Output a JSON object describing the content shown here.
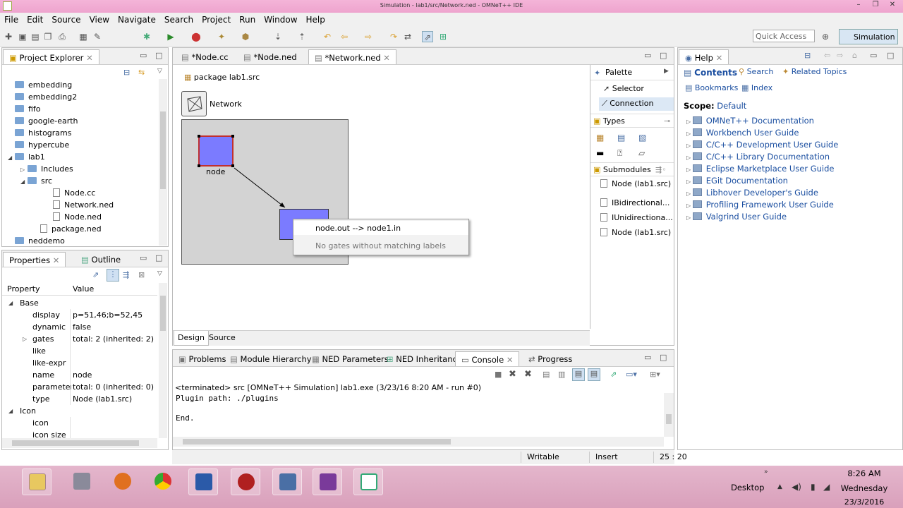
{
  "window": {
    "title": "Simulation - lab1/src/Network.ned - OMNeT++ IDE",
    "minimize": "–",
    "restore": "❐",
    "close": "✕"
  },
  "menu": [
    "File",
    "Edit",
    "Source",
    "View",
    "Navigate",
    "Search",
    "Project",
    "Run",
    "Window",
    "Help"
  ],
  "toolbar": {
    "quick_access": "Quick Access",
    "perspective": "Simulation"
  },
  "project_explorer": {
    "tab": "Project Explorer",
    "items": [
      {
        "label": "embedding",
        "type": "folder",
        "indent": 1
      },
      {
        "label": "embedding2",
        "type": "folder",
        "indent": 1
      },
      {
        "label": "fifo",
        "type": "folder",
        "indent": 1
      },
      {
        "label": "google-earth",
        "type": "folder",
        "indent": 1
      },
      {
        "label": "histograms",
        "type": "folder",
        "indent": 1
      },
      {
        "label": "hypercube",
        "type": "folder",
        "indent": 1
      },
      {
        "label": "lab1",
        "type": "folder-open",
        "indent": 1
      },
      {
        "label": "Includes",
        "type": "folder",
        "indent": 2
      },
      {
        "label": "src",
        "type": "folder-open",
        "indent": 2
      },
      {
        "label": "Node.cc",
        "type": "file",
        "indent": 3
      },
      {
        "label": "Network.ned",
        "type": "file",
        "indent": 3
      },
      {
        "label": "Node.ned",
        "type": "file",
        "indent": 3
      },
      {
        "label": "package.ned",
        "type": "file",
        "indent": 2
      },
      {
        "label": "neddemo",
        "type": "folder",
        "indent": 1
      }
    ]
  },
  "properties": {
    "tab": "Properties",
    "tab2": "Outline",
    "col_property": "Property",
    "col_value": "Value",
    "rows": [
      {
        "p": "Base",
        "v": "",
        "level": 0
      },
      {
        "p": "display",
        "v": "p=51,46;b=52,45",
        "level": 1
      },
      {
        "p": "dynamic",
        "v": "false",
        "level": 1
      },
      {
        "p": "gates",
        "v": "total: 2 (inherited: 2)",
        "level": 1
      },
      {
        "p": "like",
        "v": "",
        "level": 1
      },
      {
        "p": "like-expr",
        "v": "",
        "level": 1
      },
      {
        "p": "name",
        "v": "node",
        "level": 1
      },
      {
        "p": "parameter",
        "v": "total: 0 (inherited: 0)",
        "level": 1
      },
      {
        "p": "type",
        "v": "Node (lab1.src)",
        "level": 1
      },
      {
        "p": "Icon",
        "v": "",
        "level": 0
      },
      {
        "p": "icon",
        "v": "",
        "level": 1
      },
      {
        "p": "icon size",
        "v": "",
        "level": 1
      }
    ]
  },
  "editor": {
    "tabs": [
      "*Node.cc",
      "*Node.ned",
      "*Network.ned"
    ],
    "package": "package lab1.src",
    "network_label": "Network",
    "node_label": "node",
    "popup": {
      "item1": "node.out --> node1.in",
      "item2": "No gates without matching labels"
    },
    "bottom_tabs": [
      "Design",
      "Source"
    ]
  },
  "palette": {
    "title": "Palette",
    "selector": "Selector",
    "connection": "Connection",
    "types": "Types",
    "submodules": "Submodules",
    "sub_items": [
      "IBidirectional...",
      "IUnidirectiona...",
      "Node (lab1.src)"
    ],
    "first_sub": "Node (lab1.src)"
  },
  "console": {
    "tabs": [
      "Problems",
      "Module Hierarchy",
      "NED Parameters",
      "NED Inheritance",
      "Console",
      "Progress"
    ],
    "status": "<terminated> src [OMNeT++ Simulation] lab1.exe (3/23/16 8:20 AM - run #0)",
    "lines": [
      "Plugin path: ./plugins",
      "",
      "End."
    ]
  },
  "help": {
    "tab": "Help",
    "contents": "Contents",
    "search": "Search",
    "related": "Related Topics",
    "bookmarks": "Bookmarks",
    "index": "Index",
    "scope_label": "Scope:",
    "scope_value": "Default",
    "items": [
      "OMNeT++ Documentation",
      "Workbench User Guide",
      "C/C++ Development User Guide",
      "C/C++ Library Documentation",
      "Eclipse Marketplace User Guide",
      "EGit Documentation",
      "Libhover Developer's Guide",
      "Profiling Framework User Guide",
      "Valgrind User Guide"
    ]
  },
  "statusbar": {
    "writable": "Writable",
    "insert": "Insert",
    "position": "25 : 20"
  },
  "taskbar": {
    "desktop": "Desktop",
    "time": "8:26 AM",
    "day": "Wednesday",
    "date": "23/3/2016"
  }
}
